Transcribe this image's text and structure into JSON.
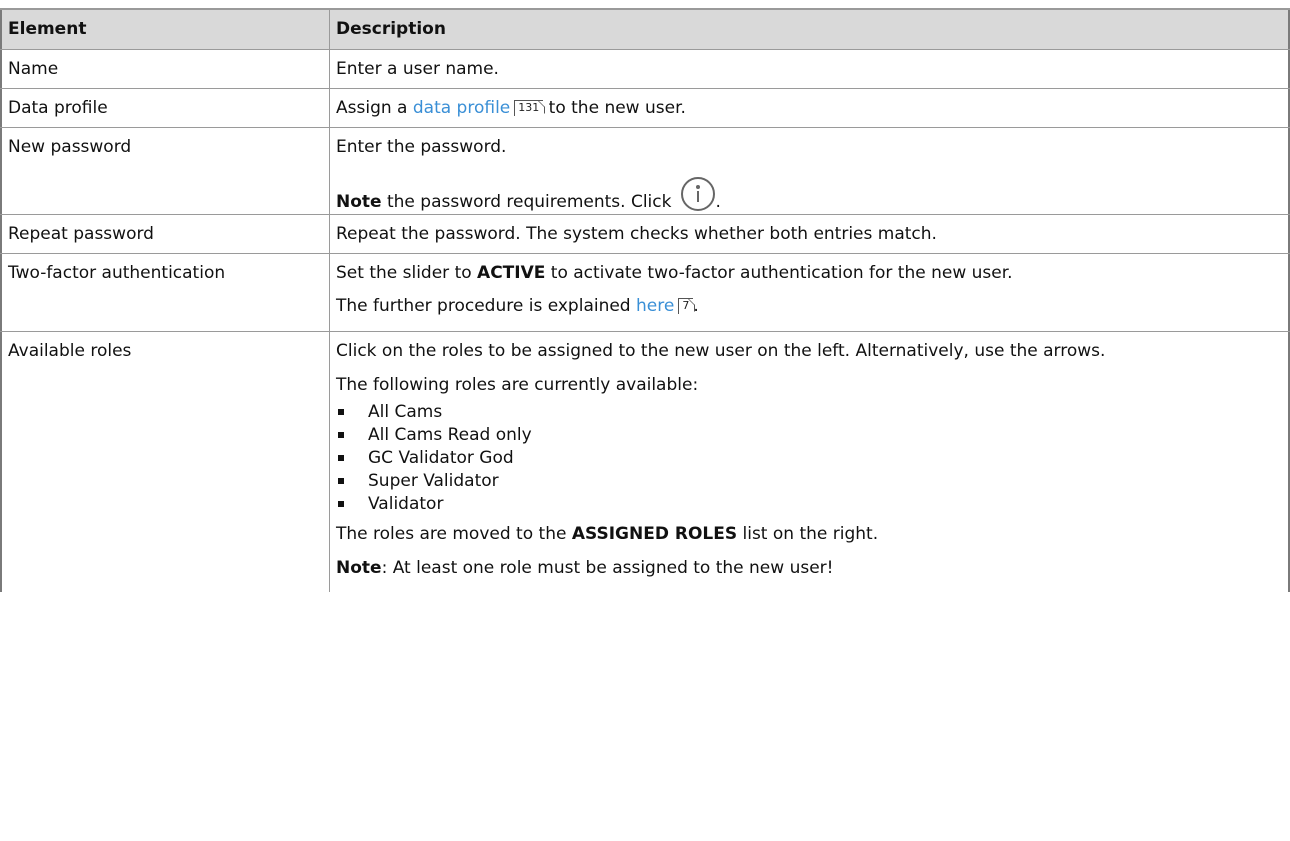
{
  "table": {
    "headers": {
      "element": "Element",
      "description": "Description"
    },
    "rows": [
      {
        "element": "Name",
        "desc": "Enter a user name."
      },
      {
        "element": "Data profile",
        "desc_before": "Assign a",
        "link_text": "data profile",
        "ref": "131",
        "desc_after": " to the new user."
      },
      {
        "element": "New password",
        "desc1": "Enter the password.",
        "note_bold": "Note",
        "note_rest": " the password requirements. Click",
        "icon": "info-icon",
        "note_end": "."
      },
      {
        "element": "Repeat password",
        "desc": "Repeat the password. The system checks whether both entries match."
      },
      {
        "element": "Two-factor authentication",
        "desc1_before": "Set the slider to ",
        "desc1_bold": "ACTIVE",
        "desc1_after": " to activate two-factor authentication for the new user.",
        "desc2_before": "The further procedure is explained ",
        "link_text": "here",
        "ref": "7",
        "desc2_after": "."
      },
      {
        "element": "Available roles",
        "desc1": "Click on the roles to be assigned to the new user on the left. Alternatively, use the arrows.",
        "desc2": "The following roles are currently available:",
        "roles": [
          "All Cams",
          "All Cams Read only",
          "GC Validator God",
          "Super Validator",
          "Validator"
        ],
        "desc3_before": "The roles are moved to the ",
        "desc3_bold": "ASSIGNED ROLES",
        "desc3_after": " list on the right.",
        "note_bold": "Note",
        "note_rest": ": At least one role must be assigned to the new user!"
      }
    ]
  },
  "colors": {
    "link": "#3a8fd6",
    "header_bg": "#d9d9d9"
  }
}
